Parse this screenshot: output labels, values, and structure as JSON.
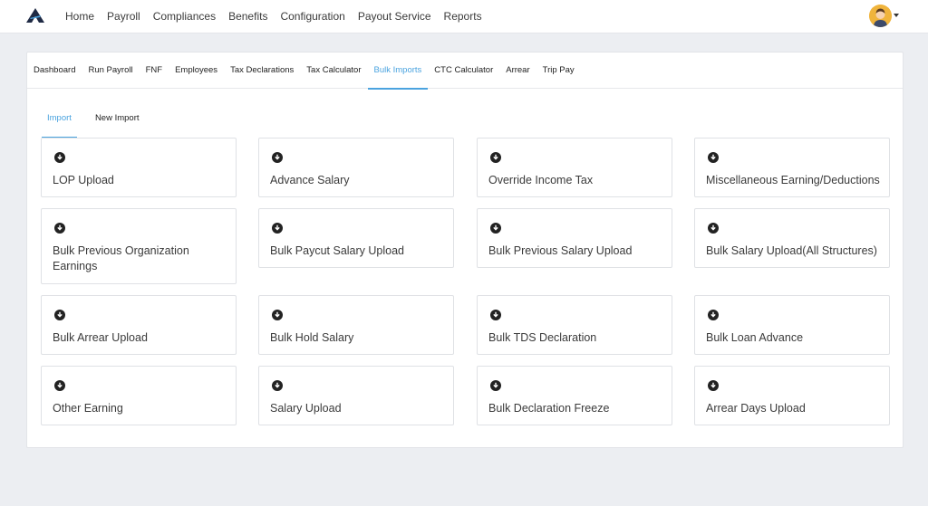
{
  "nav": {
    "items": [
      "Home",
      "Payroll",
      "Compliances",
      "Benefits",
      "Configuration",
      "Payout Service",
      "Reports"
    ]
  },
  "subnav": {
    "items": [
      "Dashboard",
      "Run Payroll",
      "FNF",
      "Employees",
      "Tax Declarations",
      "Tax Calculator",
      "Bulk Imports",
      "CTC Calculator",
      "Arrear",
      "Trip Pay"
    ],
    "active": "Bulk Imports"
  },
  "tabs": {
    "items": [
      "Import",
      "New Import"
    ],
    "active": "Import"
  },
  "cards": [
    "LOP Upload",
    "Advance Salary",
    "Override Income Tax",
    "Miscellaneous Earning/Deductions",
    "Bulk Previous Organization Earnings",
    "Bulk Paycut Salary Upload",
    "Bulk Previous Salary Upload",
    "Bulk Salary Upload(All Structures)",
    "Bulk Arrear Upload",
    "Bulk Hold Salary",
    "Bulk TDS Declaration",
    "Bulk Loan Advance",
    "Other Earning",
    "Salary Upload",
    "Bulk Declaration Freeze",
    "Arrear Days Upload"
  ],
  "icons": {
    "card_icon": "download-circle-icon",
    "logo": "app-logo-icon",
    "avatar": "user-avatar"
  },
  "colors": {
    "accent": "#4aa3df",
    "avatar_bg": "#f0b43c"
  }
}
